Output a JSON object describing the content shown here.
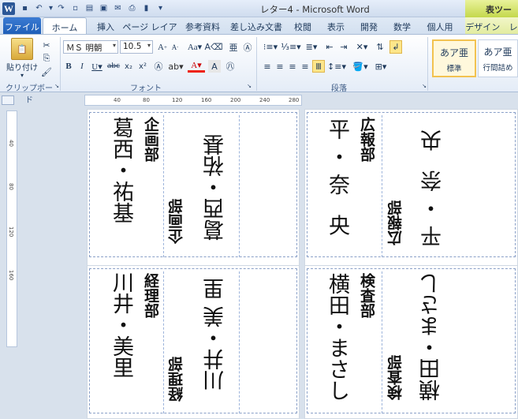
{
  "window": {
    "title": "レター4 - Microsoft Word",
    "context_title": "表ツール"
  },
  "tabs": [
    {
      "label": "ファイル"
    },
    {
      "label": "ホーム"
    },
    {
      "label": "挿入"
    },
    {
      "label": "ページ レイアウト"
    },
    {
      "label": "参考資料"
    },
    {
      "label": "差し込み文書"
    },
    {
      "label": "校閲"
    },
    {
      "label": "表示"
    },
    {
      "label": "開発"
    },
    {
      "label": "数学"
    },
    {
      "label": "個人用"
    },
    {
      "label": "デザイン"
    },
    {
      "label": "レ"
    }
  ],
  "ribbon": {
    "paste_label": "貼り付け",
    "clipboard_group": "クリップボード",
    "font_group": "フォント",
    "paragraph_group": "段落",
    "font_name": "ＭＳ 明朝",
    "font_size": "10.5",
    "style1_sample": "あア亜",
    "style1_label": "標準",
    "style2_sample": "あア亜",
    "style2_label": "行間詰め"
  },
  "rulers": {
    "h_ticks": [
      "40",
      "80",
      "120",
      "160",
      "200",
      "240",
      "280"
    ],
    "v_ticks": [
      "40",
      "80",
      "120",
      "160"
    ]
  },
  "cards": [
    {
      "name_big": "葛西・祐基",
      "dept_big": "企画部",
      "name_small": "葛西・祐基",
      "dept_small": "企画部"
    },
    {
      "name_big": "平・奈 央",
      "dept_big": "広報部",
      "name_small": "平・奈 央",
      "dept_small": "広報部"
    },
    {
      "name_big": "川井・美里",
      "dept_big": "経理部",
      "name_small": "川井・美 里",
      "dept_small": "経理部"
    },
    {
      "name_big": "横田・まさし",
      "dept_big": "検査部",
      "name_small": "横田・まさし",
      "dept_small": "検査部"
    }
  ]
}
